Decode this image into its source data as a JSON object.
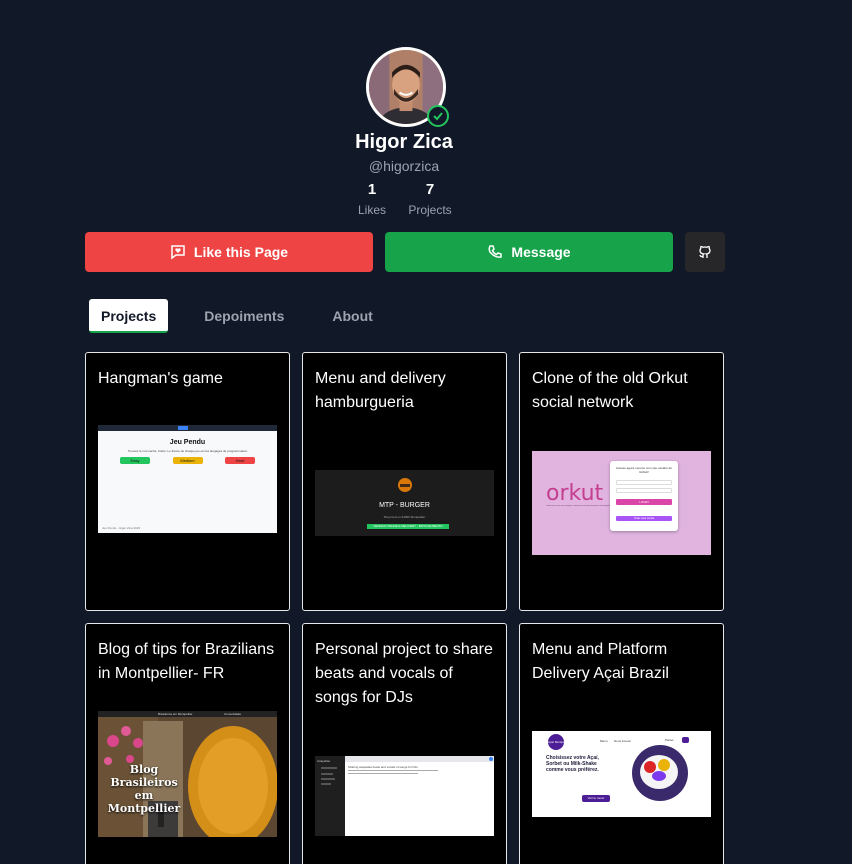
{
  "profile": {
    "name": "Higor Zica",
    "handle": "@higorzica",
    "likes_count": "1",
    "likes_label": "Likes",
    "projects_count": "7",
    "projects_label": "Projects"
  },
  "actions": {
    "like_label": "Like this Page",
    "message_label": "Message",
    "github_icon": "github-icon"
  },
  "tabs": [
    {
      "label": "Projects",
      "active": true
    },
    {
      "label": "Depoiments",
      "active": false
    },
    {
      "label": "About",
      "active": false
    }
  ],
  "projects": [
    {
      "title": "Hangman's game",
      "thumb": {
        "heading": "Jeu Pendu",
        "subtitle": "Trouvez le mot caché, indice: Le thème de chaque jeu est les langages de programmation",
        "buttons": [
          "Easy",
          "Medium",
          "Hard"
        ],
        "footer": "Jeu Pendu - Higor Zica 2023"
      }
    },
    {
      "title": "Menu and delivery hamburgueria",
      "thumb": {
        "heading": "MTP - BURGER",
        "subtitle": "Shop here in 34000 Montpellier",
        "banner": "VENDAS ONLINE E DELIVERY - BOTA DE BENTO"
      }
    },
    {
      "title": "Clone of the old Orkut social network",
      "thumb": {
        "logo": "orkut",
        "tagline": "Conecte-se aos seus amigos e familiares usando recados e mensagens instantâneas",
        "login_text": "Acesse agora mesmo com seu usuário do Github!",
        "login_button": "LOGIN",
        "signup_button": "Criar sua conta"
      }
    },
    {
      "title": "Blog of tips for Brazilians in Montpellier- FR",
      "thumb": {
        "overlay": "Blog Brasileiros em Montpellier",
        "nav": [
          "Brasileiros em Montpellier",
          "Comunidade"
        ]
      }
    },
    {
      "title": "Personal project to share beats and vocals of songs for DJs",
      "thumb": {
        "sidebar_title": "Acapellas",
        "body_text": "Sharing acapellas beats and vocals of songs for DJs"
      }
    },
    {
      "title": "Menu and Platform Delivery Açai Brazil",
      "thumb": {
        "brand": "Açaí Montpellier",
        "nav": [
          "Menu",
          "Nous trouver"
        ],
        "headline": "Choisissez votre Açaí, Sorbet ou Milk-Shake comme vous préférez.",
        "cta": "Voir le menu",
        "cart_label": "Panier"
      }
    }
  ],
  "colors": {
    "background": "#111827",
    "like": "#ef4444",
    "message": "#16a34a",
    "github": "#27272a",
    "verified": "#22c55e",
    "orkut_pink": "#e1b4e0"
  }
}
